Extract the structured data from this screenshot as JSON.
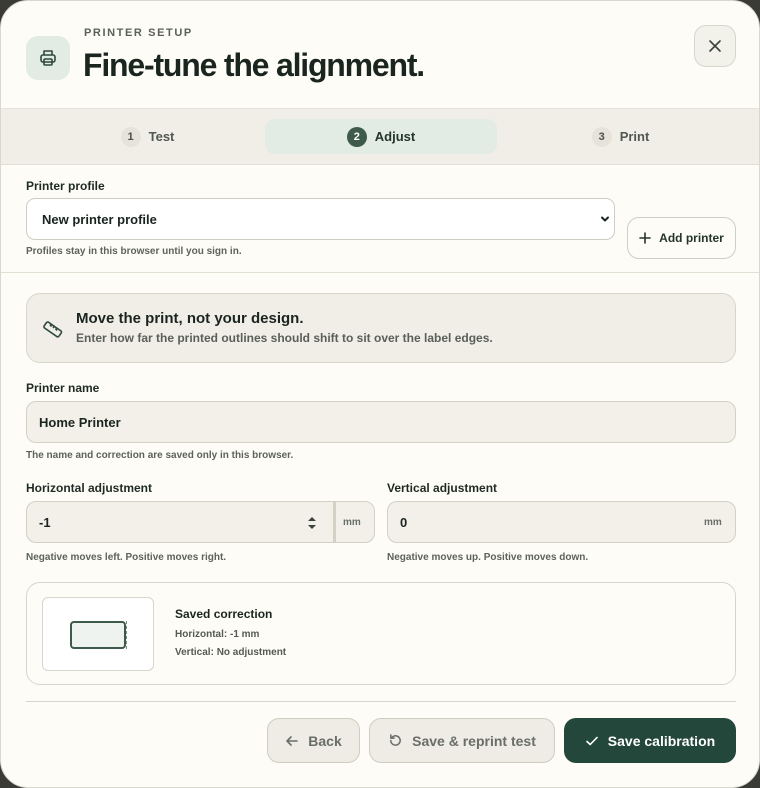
{
  "header": {
    "eyebrow": "PRINTER SETUP",
    "title": "Fine-tune the alignment.",
    "icon": "printer-icon"
  },
  "steps": [
    {
      "num": "1",
      "label": "Test",
      "active": false
    },
    {
      "num": "2",
      "label": "Adjust",
      "active": true
    },
    {
      "num": "3",
      "label": "Print",
      "active": false
    }
  ],
  "profile": {
    "label": "Printer profile",
    "selected": "New printer profile",
    "hint": "Profiles stay in this browser until you sign in.",
    "add_label": "Add printer"
  },
  "info": {
    "title": "Move the print, not your design.",
    "subtitle": "Enter how far the printed outlines should shift to sit over the label edges.",
    "icon": "ruler-icon"
  },
  "printer_name": {
    "label": "Printer name",
    "value": "Home Printer",
    "hint": "The name and correction are saved only in this browser."
  },
  "horizontal": {
    "label": "Horizontal adjustment",
    "value": "-1",
    "unit": "mm",
    "hint": "Negative moves left. Positive moves right."
  },
  "vertical": {
    "label": "Vertical adjustment",
    "value": "0",
    "unit": "mm",
    "hint": "Negative moves up. Positive moves down."
  },
  "saved": {
    "title": "Saved correction",
    "horizontal": "Horizontal: -1 mm",
    "vertical": "Vertical: No adjustment"
  },
  "footer": {
    "back": "Back",
    "reprint": "Save & reprint test",
    "save": "Save calibration"
  },
  "colors": {
    "primary": "#23473a",
    "accent_soft": "#e2ece4",
    "surface": "#f0eee6"
  }
}
